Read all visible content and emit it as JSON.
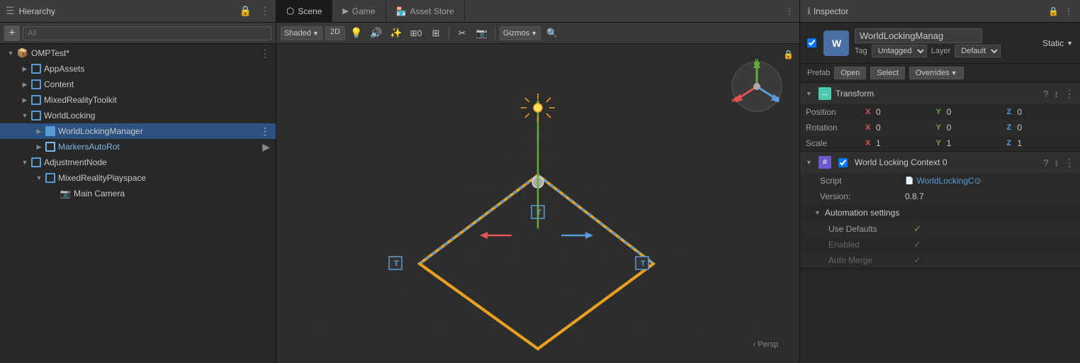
{
  "hierarchy": {
    "title": "Hierarchy",
    "search_placeholder": "All",
    "items": [
      {
        "id": "omptest",
        "label": "OMPTest*",
        "depth": 0,
        "arrow": "down",
        "icon": "cube",
        "color": "normal",
        "selected": false
      },
      {
        "id": "appassets",
        "label": "AppAssets",
        "depth": 1,
        "arrow": "right",
        "icon": "cube",
        "color": "normal",
        "selected": false
      },
      {
        "id": "content",
        "label": "Content",
        "depth": 1,
        "arrow": "right",
        "icon": "cube",
        "color": "normal",
        "selected": false
      },
      {
        "id": "mixedrealitytoolkit",
        "label": "MixedRealityToolkit",
        "depth": 1,
        "arrow": "right",
        "icon": "cube",
        "color": "normal",
        "selected": false
      },
      {
        "id": "worldlocking",
        "label": "WorldLocking",
        "depth": 1,
        "arrow": "down",
        "icon": "cube",
        "color": "normal",
        "selected": false
      },
      {
        "id": "worldlockingmanager",
        "label": "WorldLockingManager",
        "depth": 2,
        "arrow": "right",
        "icon": "cube-blue",
        "color": "selected",
        "selected": true
      },
      {
        "id": "markersautorot",
        "label": "MarkersAutoRot",
        "depth": 2,
        "arrow": "right",
        "icon": "cube",
        "color": "blue-text",
        "selected": false
      },
      {
        "id": "adjustmentnode",
        "label": "AdjustmentNode",
        "depth": 1,
        "arrow": "down",
        "icon": "cube",
        "color": "normal",
        "selected": false
      },
      {
        "id": "mixedrealityplayspace",
        "label": "MixedRealityPlayspace",
        "depth": 2,
        "arrow": "down",
        "icon": "cube",
        "color": "normal",
        "selected": false
      },
      {
        "id": "maincamera",
        "label": "Main Camera",
        "depth": 3,
        "arrow": "empty",
        "icon": "camera",
        "color": "normal",
        "selected": false
      }
    ]
  },
  "scene": {
    "tabs": [
      {
        "id": "scene",
        "label": "Scene",
        "icon": "⬡",
        "active": true
      },
      {
        "id": "game",
        "label": "Game",
        "icon": "▶",
        "active": false
      },
      {
        "id": "assetstore",
        "label": "Asset Store",
        "icon": "🏪",
        "active": false
      }
    ],
    "toolbar": {
      "shading": "Shaded",
      "mode_2d": "2D",
      "gizmos": "Gizmos"
    }
  },
  "inspector": {
    "title": "Inspector",
    "object_name": "WorldLockingManag",
    "static_label": "Static",
    "tag_label": "Tag",
    "tag_value": "Untagged",
    "layer_label": "Layer",
    "layer_value": "Default",
    "prefab_label": "Prefab",
    "open_label": "Open",
    "select_label": "Select",
    "overrides_label": "Overrides",
    "transform": {
      "title": "Transform",
      "position_label": "Position",
      "rotation_label": "Rotation",
      "scale_label": "Scale",
      "position": {
        "x": "0",
        "y": "0",
        "z": "0"
      },
      "rotation": {
        "x": "0",
        "y": "0",
        "z": "0"
      },
      "scale": {
        "x": "1",
        "y": "1",
        "z": "1"
      }
    },
    "world_locking_context": {
      "title": "World Locking Context 0",
      "script_label": "Script",
      "script_value": "WorldLockingC⊙",
      "version_label": "Version:",
      "version_value": "0.8.7",
      "automation_label": "Automation settings",
      "use_defaults_label": "Use Defaults",
      "enabled_label": "Enabled",
      "auto_merge_label": "Auto Merge",
      "use_defaults_checked": true,
      "enabled_checked": true,
      "auto_merge_checked": true
    }
  }
}
